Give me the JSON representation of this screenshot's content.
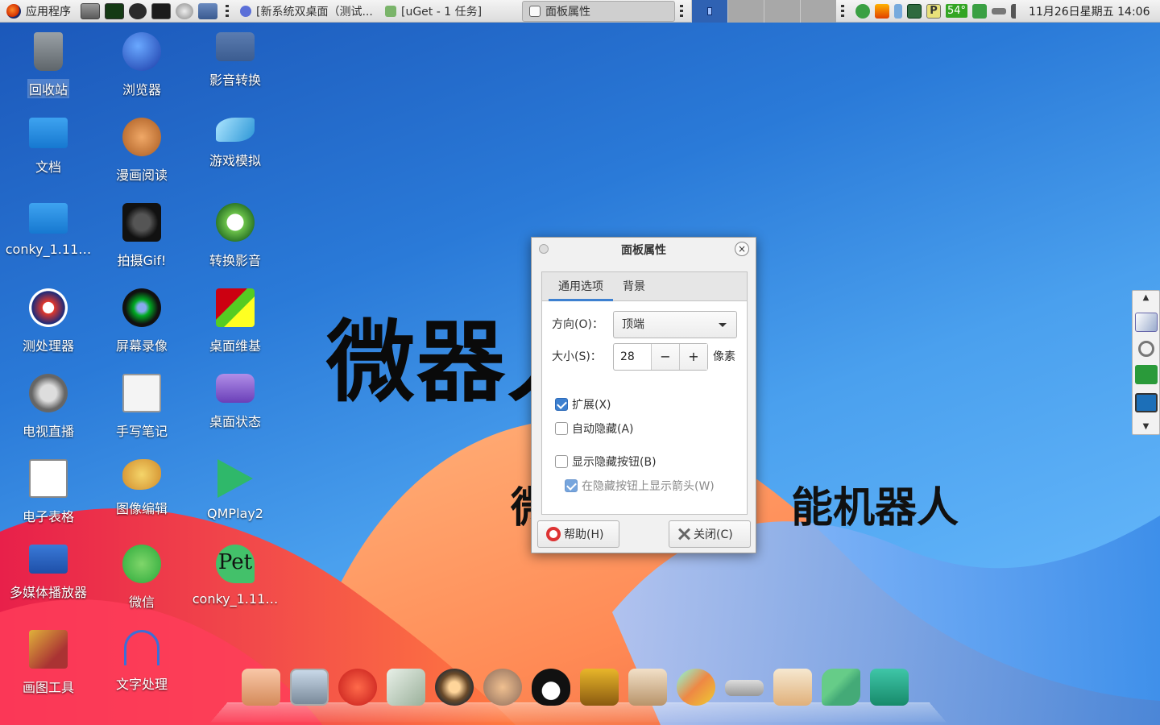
{
  "top_panel": {
    "apps_menu_label": "应用程序",
    "tasks": [
      {
        "label": "[新系统双桌面（测试..."
      },
      {
        "label": "[uGet - 1 任务]"
      },
      {
        "label": "面板属性"
      }
    ],
    "temperature": "54°",
    "tray_p": "P",
    "clock": "11月26日星期五 14:06"
  },
  "wallpaper": {
    "big_text": "微器人",
    "small_text_left": "微",
    "small_text_right": "能机器人"
  },
  "desktop_icons": [
    {
      "label": "回收站",
      "icon": "trash-icon"
    },
    {
      "label": "浏览器",
      "icon": "browser-icon"
    },
    {
      "label": "影音转换",
      "icon": "video-convert-icon"
    },
    {
      "label": "文档",
      "icon": "documents-folder-icon"
    },
    {
      "label": "漫画阅读",
      "icon": "comic-reader-icon"
    },
    {
      "label": "游戏模拟",
      "icon": "game-emulator-icon"
    },
    {
      "label": "conky_1.11…",
      "icon": "folder-icon"
    },
    {
      "label": "拍摄Gif!",
      "icon": "camera-icon"
    },
    {
      "label": "转换影音",
      "icon": "media-convert-icon"
    },
    {
      "label": "测处理器",
      "icon": "cpu-test-icon"
    },
    {
      "label": "屏幕录像",
      "icon": "screen-recorder-icon"
    },
    {
      "label": "桌面维基",
      "icon": "desktop-wiki-icon"
    },
    {
      "label": "电视直播",
      "icon": "tv-live-icon"
    },
    {
      "label": "手写笔记",
      "icon": "handwriting-notes-icon"
    },
    {
      "label": "桌面状态",
      "icon": "desktop-status-icon"
    },
    {
      "label": "电子表格",
      "icon": "spreadsheet-icon"
    },
    {
      "label": "图像编辑",
      "icon": "image-editor-icon"
    },
    {
      "label": "QMPlay2",
      "icon": "qmplay2-icon"
    },
    {
      "label": "多媒体播放器",
      "icon": "media-player-icon"
    },
    {
      "label": "微信",
      "icon": "wechat-icon"
    },
    {
      "label": "conky_1.11…",
      "icon": "pet-icon",
      "art_text": "Pet"
    },
    {
      "label": "画图工具",
      "icon": "paint-tool-icon"
    },
    {
      "label": "文字处理",
      "icon": "word-processor-icon"
    }
  ],
  "dialog": {
    "title": "面板属性",
    "close_glyph": "×",
    "tabs": [
      "通用选项",
      "背景"
    ],
    "orientation_label": "方向(O)：",
    "orientation_value": "顶端",
    "size_label": "大小(S)：",
    "size_value": "28",
    "size_minus": "−",
    "size_plus": "+",
    "size_unit": "像素",
    "checkboxes": [
      {
        "label": "扩展(X)",
        "checked": true
      },
      {
        "label": "自动隐藏(A)",
        "checked": false
      },
      {
        "label": "显示隐藏按钮(B)",
        "checked": false
      },
      {
        "label": "在隐藏按钮上显示箭头(W)",
        "checked": true,
        "disabled": true
      }
    ],
    "help_button": "帮助(H)",
    "close_button": "关闭(C)"
  },
  "side_panel": {
    "up_arrow": "▲",
    "down_arrow": "▼"
  }
}
